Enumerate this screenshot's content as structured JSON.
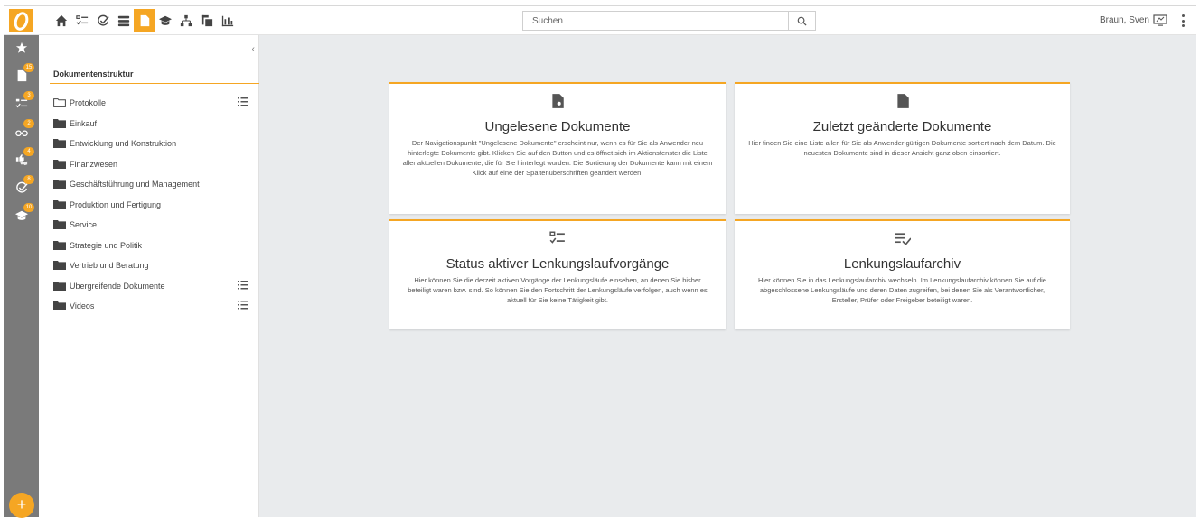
{
  "header": {
    "nav": [
      {
        "name": "home-icon"
      },
      {
        "name": "checklist-icon"
      },
      {
        "name": "approval-icon"
      },
      {
        "name": "menu-icon"
      },
      {
        "name": "document-icon",
        "active": true
      },
      {
        "name": "graduation-icon"
      },
      {
        "name": "org-chart-icon"
      },
      {
        "name": "copy-icon"
      },
      {
        "name": "bar-chart-icon"
      }
    ],
    "search_placeholder": "Suchen",
    "user": "Braun, Sven"
  },
  "rail": {
    "items": [
      {
        "icon": "star-icon",
        "badge": ""
      },
      {
        "icon": "document-icon",
        "badge": "15"
      },
      {
        "icon": "checklist-icon",
        "badge": "3"
      },
      {
        "icon": "glasses-icon",
        "badge": "2"
      },
      {
        "icon": "thumbs-icon",
        "badge": "4"
      },
      {
        "icon": "approval-icon",
        "badge": "8"
      },
      {
        "icon": "graduation-icon",
        "badge": "10"
      }
    ],
    "fab_label": "+"
  },
  "panel": {
    "title": "Dokumentenstruktur",
    "items": [
      {
        "label": "Protokolle",
        "open": true,
        "has_list": true
      },
      {
        "label": "Einkauf"
      },
      {
        "label": "Entwicklung und Konstruktion"
      },
      {
        "label": "Finanzwesen"
      },
      {
        "label": "Geschäftsführung und Management"
      },
      {
        "label": "Produktion und Fertigung"
      },
      {
        "label": "Service"
      },
      {
        "label": "Strategie und Politik"
      },
      {
        "label": "Vertrieb und Beratung"
      },
      {
        "label": "Übergreifende Dokumente",
        "has_list": true
      },
      {
        "label": "Videos",
        "has_list": true
      }
    ]
  },
  "cards": [
    {
      "title": "Ungelesene Dokumente",
      "body": "Der Navigationspunkt \"Ungelesene Dokumente\" erscheint nur, wenn es für Sie als Anwender neu hinterlegte Dokumente gibt. Klicken Sie auf den Button und es öffnet sich im Aktionsfenster die Liste aller aktuellen Dokumente, die für Sie hinterlegt wurden. Die Sortierung der Dokumente kann mit einem Klick auf eine der Spaltenüberschriften geändert werden."
    },
    {
      "title": "Zuletzt geänderte Dokumente",
      "body": "Hier finden Sie eine Liste aller, für Sie als Anwender gültigen Dokumente sortiert nach dem Datum. Die neuesten Dokumente sind in dieser Ansicht ganz oben einsortiert."
    },
    {
      "title": "Status aktiver Lenkungslaufvorgänge",
      "body": "Hier können Sie die derzeit aktiven Vorgänge der Lenkungsläufe einsehen, an denen Sie bisher beteiligt waren bzw. sind. So können Sie den Fortschritt der Lenkungsläufe verfolgen, auch wenn es aktuell für Sie keine Tätigkeit gibt."
    },
    {
      "title": "Lenkungslaufarchiv",
      "body": "Hier können Sie in das Lenkungslaufarchiv wechseln. Im Lenkungslaufarchiv können Sie auf die abgeschlossene Lenkungsläufe und deren Daten zugreifen, bei denen Sie als Verantwortlicher, Ersteller, Prüfer oder Freigeber beteiligt waren."
    }
  ],
  "colors": {
    "accent": "#f5a623",
    "rail": "#7a7a7a",
    "background": "#e9ebed"
  }
}
